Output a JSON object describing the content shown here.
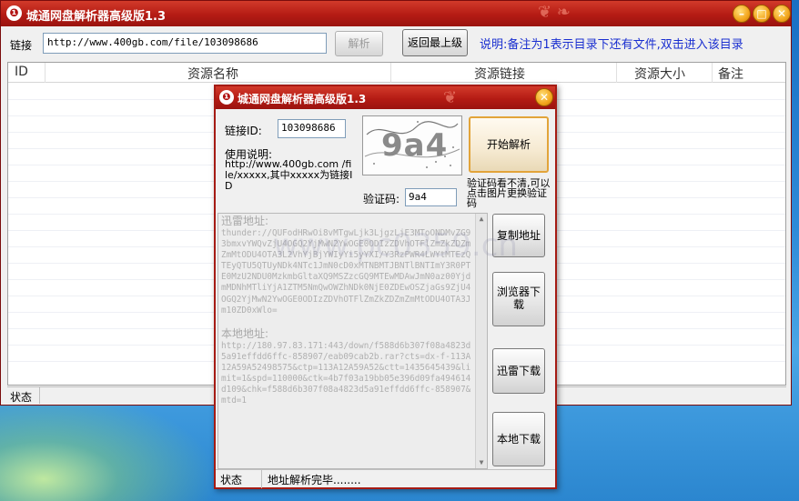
{
  "app": {
    "title": "城通网盘解析器高级版1.3",
    "logo_glyph": "❶"
  },
  "window_controls": {
    "minimize": "–",
    "maximize": "□",
    "close": "✕"
  },
  "toolbar": {
    "link_label": "链接",
    "link_value": "http://www.400gb.com/file/103098686",
    "parse_button": "解析",
    "back_button": "返回最上级",
    "note": "说明:备注为1表示目录下还有文件,双击进入该目录"
  },
  "table": {
    "columns": [
      "ID",
      "资源名称",
      "资源链接",
      "资源大小",
      "备注"
    ]
  },
  "status": {
    "label": "状态",
    "value": ""
  },
  "dialog": {
    "title": "城通网盘解析器高级版1.3",
    "close": "✕",
    "link_id_label": "链接ID:",
    "link_id_value": "103098686",
    "usage_title": "使用说明:",
    "usage_text": "http://www.400gb.com /file/xxxxx,其中xxxxx为链接ID",
    "captcha_text": "9a4",
    "captcha_label": "验证码:",
    "captcha_value": "9a4",
    "start_button": "开始解析",
    "captcha_hint": "验证码看不清,可以点击图片更换验证码",
    "thunder_heading": "迅雷地址:",
    "thunder_url": "thunder://QUFodHRwOi8vMTgwLjk3LjgzLjE3MToONDMvZG93bmxvYWQvZjU4OGQ2YjMwN2YwOGE0ODIzZDVhOTFlZmZkZDZmZmMtODU4OTA3L2VhYjBjYWIyYi5yYXI/Y3RzPWR4LWYtMTEzQTEyQTU5QTUyNDk4NTc1JmN0cD0xMTNBMTJBNTlBNTImY3R0PTE0MzU2NDU0MzkmbGltaXQ9MSZzcGQ9MTEwMDAwJmN0az00YjdmMDNhMTliYjA1ZTM5NmQwOWZhNDk0NjE0ZDEwOSZjaGs9ZjU4OGQ2YjMwN2YwOGE0ODIzZDVhOTFlZmZkZDZmZmMtODU4OTA3Jm10ZD0xWlo=",
    "local_heading": "本地地址:",
    "local_url": "http://180.97.83.171:443/down/f588d6b307f08a4823d5a91effdd6ffc-858907/eab09cab2b.rar?cts=dx-f-113A12A59A52498575&ctp=113A12A59A52&ctt=1435645439&limit=1&spd=110000&ctk=4b7f03a19bb05e396d09fa494614d109&chk=f588d6b307f08a4823d5a91effdd6ffc-858907&mtd=1",
    "copy_button": "复制地址",
    "browser_button": "浏览器下载",
    "thunder_button": "迅雷下载",
    "local_button": "本地下载",
    "status_label": "状态",
    "status_value": "地址解析完毕........"
  },
  "watermark": "www.pc0359.cn",
  "colors": {
    "titlebar": "#b41b14",
    "note": "#1a2fd0",
    "accent_button": "#e2a43a"
  }
}
